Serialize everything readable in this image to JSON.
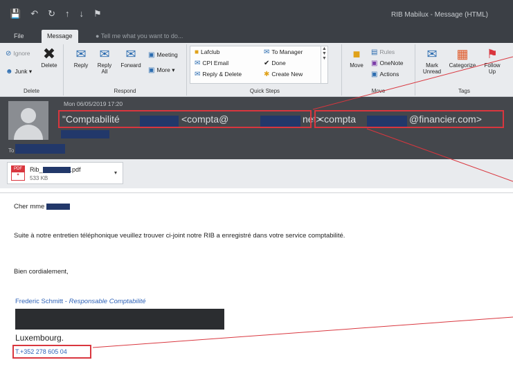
{
  "window": {
    "qat_icons": [
      "save-icon",
      "undo-icon",
      "redo-icon",
      "up-icon",
      "down-icon",
      "tag-icon"
    ],
    "title": "RIB Mabilux - Message (HTML)"
  },
  "tabs": {
    "file": "File",
    "message": "Message",
    "tell_me": "Tell me what you want to do..."
  },
  "ribbon": {
    "delete_group": {
      "label": "Delete",
      "ignore": "Ignore",
      "delete": "Delete",
      "junk": "Junk"
    },
    "respond_group": {
      "label": "Respond",
      "reply": "Reply",
      "reply_all_1": "Reply",
      "reply_all_2": "All",
      "forward": "Forward",
      "meeting": "Meeting",
      "more": "More"
    },
    "quick_steps": {
      "label": "Quick Steps",
      "items": [
        "Lafclub",
        "CPI Email",
        "Reply & Delete",
        "To Manager",
        "Done",
        "Create New"
      ]
    },
    "move_group": {
      "label": "Move",
      "move": "Move",
      "rules": "Rules",
      "onenote": "OneNote",
      "actions": "Actions"
    },
    "tags_group": {
      "label": "Tags",
      "mark_1": "Mark",
      "mark_2": "Unread",
      "categorize": "Categorize",
      "follow_1": "Follow",
      "follow_2": "Up"
    }
  },
  "header": {
    "date": "Mon 06/05/2019 17:20",
    "from_part1": "\"Comptabilité",
    "from_part2": "<compta@",
    "from_part3": "net>",
    "from_part4": "<compta",
    "from_part5": "@financier.com>",
    "to_label": "To"
  },
  "attachment": {
    "name_prefix": "Rib_",
    "name_suffix": ".pdf",
    "size": "533 KB",
    "type_label": "PDF"
  },
  "body": {
    "greeting": "Cher mme",
    "paragraph": "Suite à notre entretien téléphonique veuillez trouver ci-joint notre RIB a enregistré dans votre service comptabilité.",
    "closing": "Bien cordialement,",
    "sig_name": "Frederic Schmitt",
    "sig_sep": " - ",
    "sig_title": "Responsable Comptabilité",
    "city": "Luxembourg.",
    "phone": "T.+352 278 605 04"
  },
  "colors": {
    "annotation_red": "#d9363e",
    "redaction_blue": "#22386a",
    "link_blue": "#2e62b8"
  }
}
